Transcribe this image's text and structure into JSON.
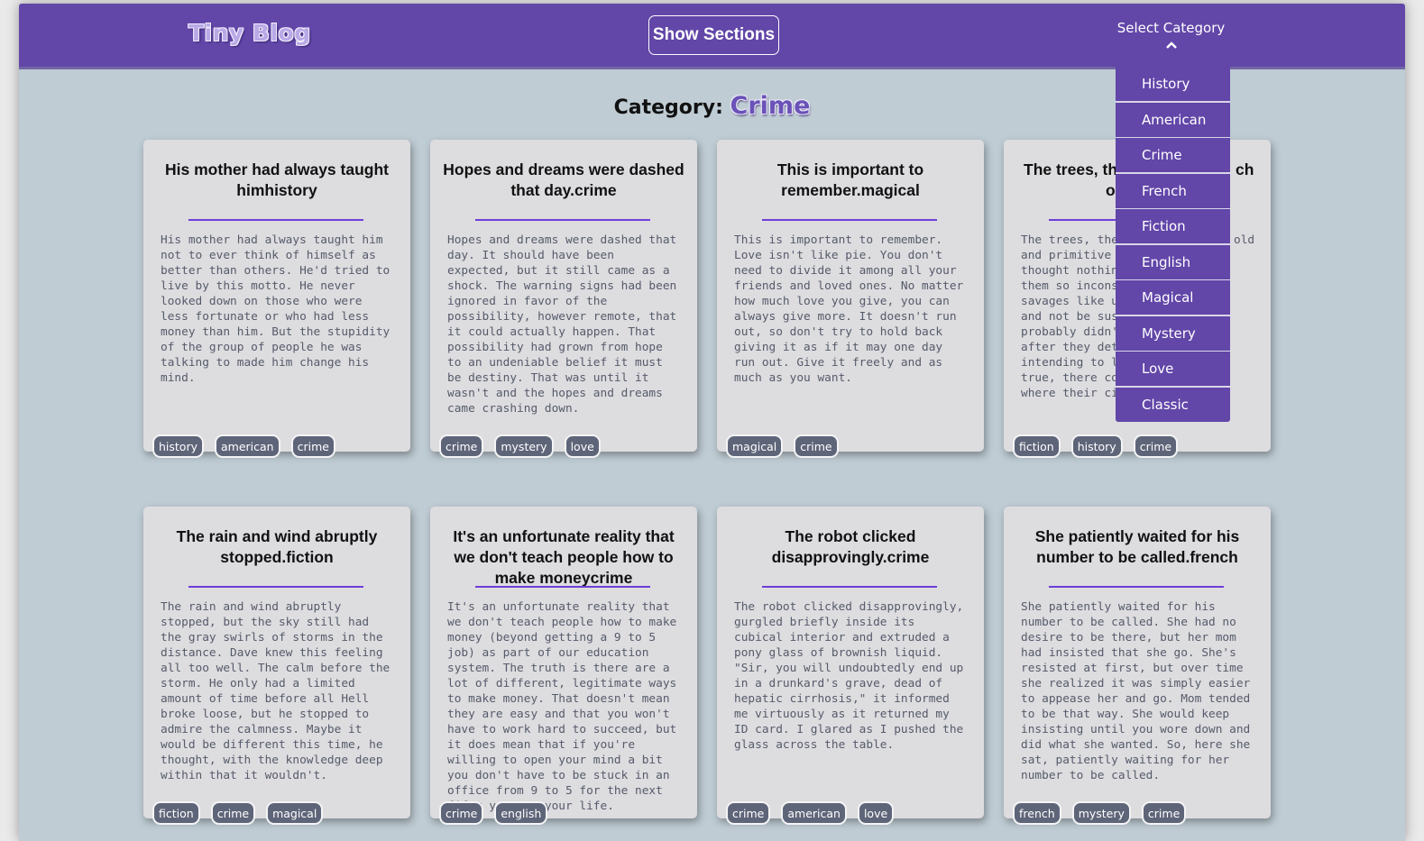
{
  "header": {
    "logo": "Tiny Blog",
    "show_sections_label": "Show Sections",
    "select_category_label": "Select Category",
    "chevron": "⌃"
  },
  "dropdown": {
    "options": [
      "History",
      "American",
      "Crime",
      "French",
      "Fiction",
      "English",
      "Magical",
      "Mystery",
      "Love",
      "Classic"
    ]
  },
  "category": {
    "prefix": "Category:",
    "name": "Crime"
  },
  "cards": [
    {
      "title": "His mother had always taught himhistory",
      "body": "His mother had always taught him not to ever think of himself as better than others. He'd tried to live by this motto. He never looked down on those who were less fortunate or who had less money than him. But the stupidity of the group of people he was talking to made him change his mind.",
      "tags": [
        "history",
        "american",
        "crime"
      ]
    },
    {
      "title": "Hopes and dreams were dashed that day.crime",
      "body": "Hopes and dreams were dashed that day. It should have been expected, but it still came as a shock. The warning signs had been ignored in favor of the possibility, however remote, that it could actually happen. That possibility had grown from hope to an undeniable belief it must be destiny. That was until it wasn't and the hopes and dreams came crashing down.",
      "tags": [
        "crime",
        "mystery",
        "love"
      ]
    },
    {
      "title": "This is important to remember.magical",
      "body": "This is important to remember. Love isn't like pie. You don't need to divide it among all your friends and loved ones. No matter how much love you give, you can always give more. It doesn't run out, so don't try to hold back giving it as if it may one day run out. Give it freely and as much as you want.",
      "tags": [
        "magical",
        "crime"
      ]
    },
    {
      "title": "The trees, the",
      "title_b": "ch",
      "title_c": "o",
      "body_lines": [
        "The trees, there",
        "and primitive te",
        "thought nothing",
        "them so inconse",
        "savages like us w",
        "and not be suspi",
        "probably didn't h",
        "after they detec",
        "intending to land",
        "true, there coul",
        "where their civil"
      ],
      "body_tail": "old",
      "tags": [
        "fiction",
        "history",
        "crime"
      ]
    },
    {
      "title": "The rain and wind abruptly stopped.fiction",
      "body": "The rain and wind abruptly stopped, but the sky still had the gray swirls of storms in the distance. Dave knew this feeling all too well. The calm before the storm. He only had a limited amount of time before all Hell broke loose, but he stopped to admire the calmness. Maybe it would be different this time, he thought, with the knowledge deep within that it wouldn't.",
      "tags": [
        "fiction",
        "crime",
        "magical"
      ]
    },
    {
      "title": "It's an unfortunate reality that we don't teach people how to make moneycrime",
      "body": "It's an unfortunate reality that we don't teach people how to make money (beyond getting a 9 to 5 job) as part of our education system. The truth is there are a lot of different, legitimate ways to make money. That doesn't mean they are easy and that you won't have to work hard to succeed, but it does mean that if you're willing to open your mind a bit you don't have to be stuck in an office from 9 to 5 for the next fifty years o your life.",
      "tags": [
        "crime",
        "english"
      ]
    },
    {
      "title": "The robot clicked disapprovingly.crime",
      "body": "The robot clicked disapprovingly, gurgled briefly inside its cubical interior and extruded a pony glass of brownish liquid. \"Sir, you will undoubtedly end up in a drunkard's grave, dead of hepatic cirrhosis,\" it informed me virtuously as it returned my ID card. I glared as I pushed the glass across the table.",
      "tags": [
        "crime",
        "american",
        "love"
      ]
    },
    {
      "title": "She patiently waited for his number to be called.french",
      "body": "She patiently waited for his number to be called. She had no desire to be there, but her mom had insisted that she go. She's resisted at first, but over time she realized it was simply easier to appease her and go. Mom tended to be that way. She would keep insisting until you wore down and did what she wanted. So, here she sat, patiently waiting for her number to be called.",
      "tags": [
        "french",
        "mystery",
        "crime"
      ]
    }
  ]
}
